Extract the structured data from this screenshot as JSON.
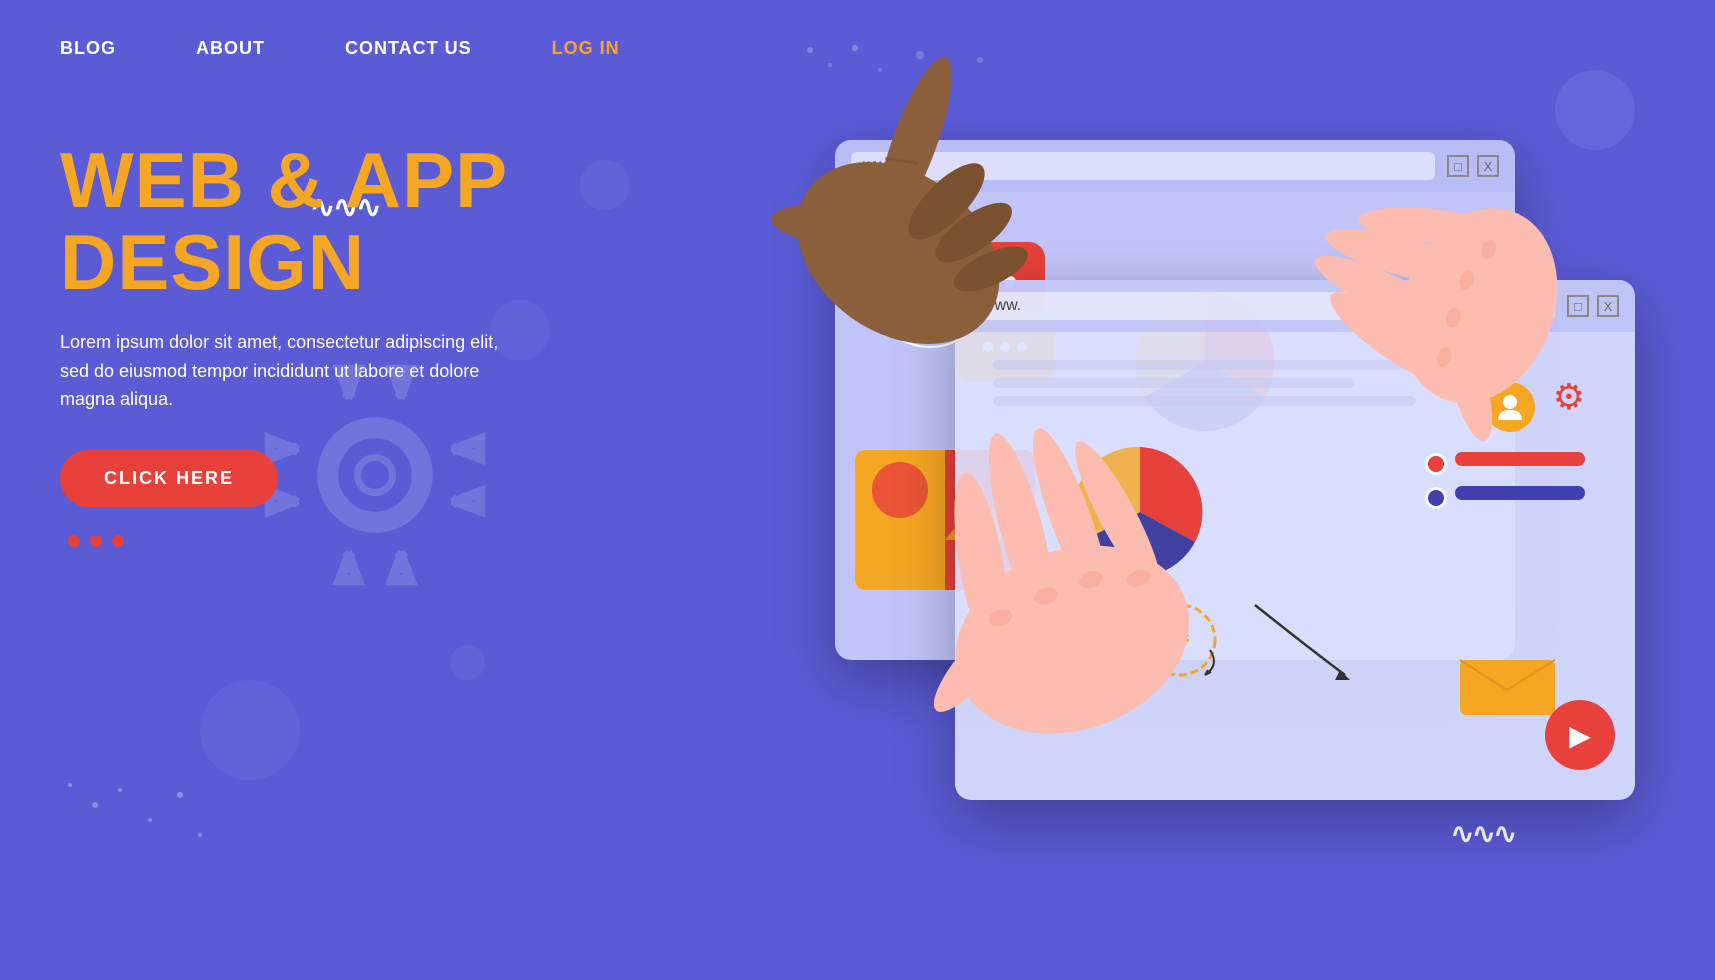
{
  "nav": {
    "items": [
      {
        "label": "BLOG",
        "active": false
      },
      {
        "label": "ABOUT",
        "active": false
      },
      {
        "label": "CONTACT US",
        "active": false
      },
      {
        "label": "LOG IN",
        "active": true
      }
    ]
  },
  "hero": {
    "title_line1": "WEB & APP",
    "title_line2": "DESIGN",
    "description": "Lorem ipsum dolor sit amet, consectetur adipiscing elit, sed do eiusmod tempor incididunt ut labore et dolore magna aliqua.",
    "cta_label": "CLICK HERE"
  },
  "browser1": {
    "url": "www.",
    "controls": [
      "□",
      "X"
    ]
  },
  "browser2": {
    "url": "www.",
    "controls": [
      "□",
      "X"
    ]
  },
  "colors": {
    "bg": "#5B5BD6",
    "accent_orange": "#F5A623",
    "accent_red": "#E8403A",
    "dark_navy": "#1a1a3a",
    "browser_bg": "rgba(210, 215, 255, 0.85)"
  }
}
